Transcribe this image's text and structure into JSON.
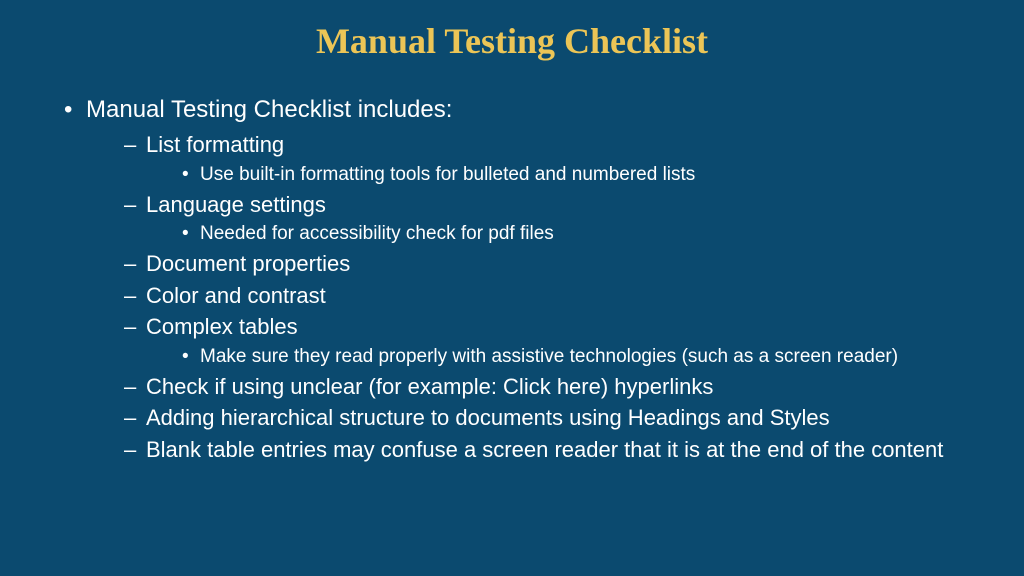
{
  "title": "Manual Testing Checklist",
  "intro": "Manual Testing Checklist includes:",
  "items": [
    {
      "label": "List formatting",
      "sub": [
        "Use built-in formatting tools for bulleted and numbered lists"
      ]
    },
    {
      "label": "Language settings",
      "sub": [
        "Needed for accessibility check for pdf files"
      ]
    },
    {
      "label": "Document properties",
      "sub": []
    },
    {
      "label": "Color and contrast",
      "sub": []
    },
    {
      "label": "Complex tables",
      "sub": [
        "Make sure they read properly with assistive technologies (such as a screen reader)"
      ]
    },
    {
      "label": "Check if using unclear (for example: Click here) hyperlinks",
      "sub": []
    },
    {
      "label": "Adding hierarchical structure to documents using Headings and Styles",
      "sub": []
    },
    {
      "label": "Blank table entries may confuse a screen reader that it is at the end of the content",
      "sub": []
    }
  ]
}
